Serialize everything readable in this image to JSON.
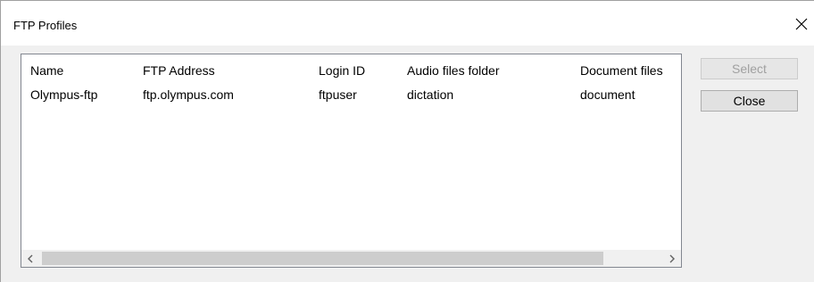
{
  "window": {
    "title": "FTP Profiles"
  },
  "list": {
    "columns": [
      "Name",
      "FTP Address",
      "Login ID",
      "Audio files folder",
      "Document files"
    ],
    "rows": [
      [
        "Olympus-ftp",
        "ftp.olympus.com",
        "ftpuser",
        "dictation",
        "document"
      ]
    ]
  },
  "buttons": {
    "select_label": "Select",
    "close_label": "Close",
    "select_enabled": false
  },
  "icons": {
    "window_close": "close-icon",
    "scroll_left": "chevron-left-icon",
    "scroll_right": "chevron-right-icon"
  },
  "colors": {
    "dialog_bg": "#f0f0f0",
    "list_border": "#828790",
    "button_bg": "#e1e1e1",
    "disabled_text": "#a0a0a0"
  }
}
